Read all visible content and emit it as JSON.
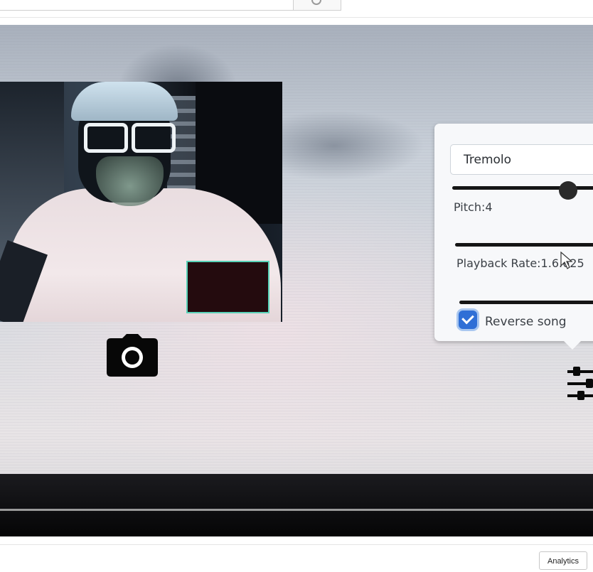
{
  "top_bar": {
    "search_input_value": "",
    "search_button_icon": "search-icon"
  },
  "screen": {
    "camera_icon": "camera-icon",
    "settings_icon": "sliders-icon"
  },
  "effects_panel": {
    "effect_select_value": "Tremolo",
    "pitch_label": "Pitch:4",
    "pitch_slider_level": 0.75,
    "playback_rate_label": "Playback Rate:1.6.625",
    "reverse_checkbox_checked": true,
    "reverse_label": "Reverse song"
  },
  "bottom_bar": {
    "analytics_label": "Analytics"
  },
  "colors": {
    "checkbox_blue": "#2f6fd6",
    "face_box_outline": "#59d3b8"
  }
}
